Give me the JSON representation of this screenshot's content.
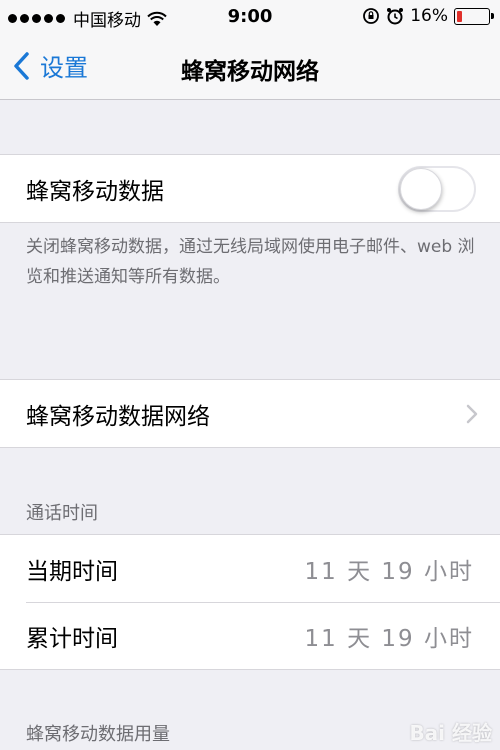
{
  "status_bar": {
    "carrier": "中国移动",
    "time": "9:00",
    "battery": "16%",
    "battery_level": 0.16,
    "battery_color": "#e0302b"
  },
  "nav": {
    "back_label": "设置",
    "title": "蜂窝移动网络"
  },
  "cellular_data": {
    "label": "蜂窝移动数据",
    "enabled": false,
    "note": "关闭蜂窝移动数据，通过无线局域网使用电子邮件、web 浏览和推送通知等所有数据。"
  },
  "cellular_network": {
    "label": "蜂窝移动数据网络"
  },
  "call_time": {
    "header": "通话时间",
    "rows": [
      {
        "label": "当期时间",
        "value": "11 天 19 小时"
      },
      {
        "label": "累计时间",
        "value": "11 天 19 小时"
      }
    ]
  },
  "usage": {
    "header": "蜂窝移动数据用量"
  },
  "watermark": "Bai 经验",
  "colors": {
    "accent": "#1a78d6",
    "background": "#efeff4"
  }
}
